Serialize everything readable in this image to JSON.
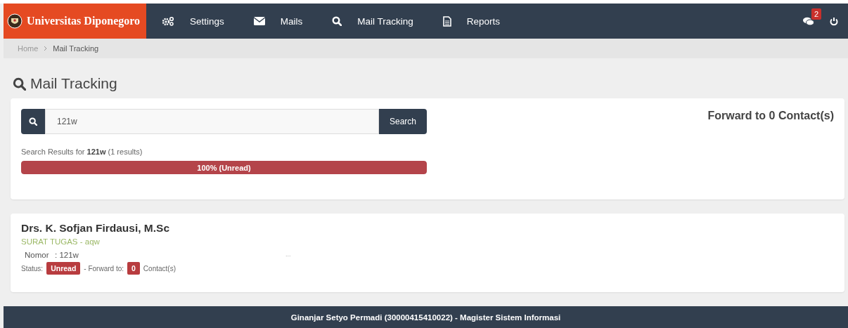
{
  "brand": {
    "title": "Universitas Diponegoro"
  },
  "nav": [
    {
      "label": "Settings",
      "kind": "gears"
    },
    {
      "label": "Mails",
      "kind": "envelope"
    },
    {
      "label": "Mail Tracking",
      "kind": "search"
    },
    {
      "label": "Reports",
      "kind": "file"
    }
  ],
  "notifications": {
    "count": "2"
  },
  "breadcrumb": [
    "Home",
    "Mail Tracking"
  ],
  "page_title": "Mail Tracking",
  "search": {
    "value": "121w",
    "button": "Search",
    "results_text": "Search Results for **121w** (1 results)",
    "progress": {
      "level": 1,
      "label": "100% (Unread)"
    }
  },
  "forward_heading": "Forward to 0 Contact(s)",
  "results": [
    {
      "name": "Drs. K. Sofjan Firdausi, M.Sc",
      "subtitle": "SURAT TUGAS - aqw",
      "nomor_label": "Nomor",
      "nomor_value": ": 121w",
      "ellipsis": "...",
      "status_label": "Status:",
      "status": "Unread",
      "forward_label": "- Forward to:",
      "forward_count": "0",
      "contacts_label": "Contact(s)"
    }
  ],
  "footer": "Ginanjar Setyo Permadi (30000415410022) - Magister Sistem Informasi"
}
